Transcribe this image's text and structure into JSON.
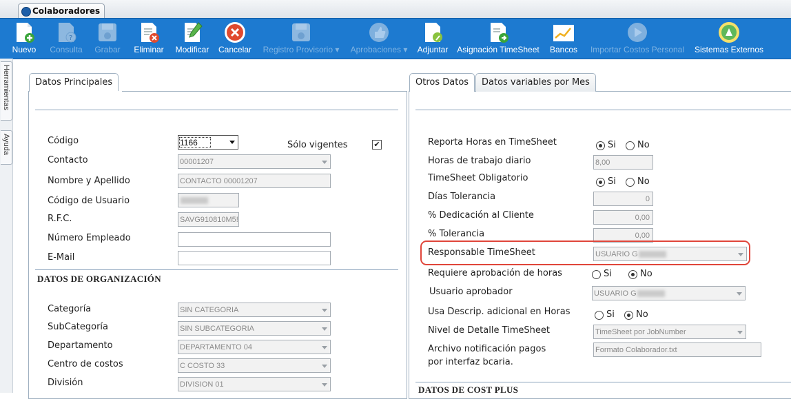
{
  "window": {
    "tab_title": "Colaboradores"
  },
  "toolbar": {
    "nuevo": "Nuevo",
    "consulta": "Consulta",
    "grabar": "Grabar",
    "eliminar": "Eliminar",
    "modificar": "Modificar",
    "cancelar": "Cancelar",
    "registro_provisorio": "Registro Provisorio ▾",
    "aprobaciones": "Aprobaciones ▾",
    "adjuntar": "Adjuntar",
    "asignacion": "Asignación TimeSheet",
    "bancos": "Bancos",
    "importar": "Importar Costos Personal",
    "sistemas": "Sistemas Externos"
  },
  "sidebar": {
    "herramientas": "Herramientas",
    "ayuda": "Ayuda"
  },
  "left": {
    "tab": "Datos Principales",
    "codigo_label": "Código",
    "codigo_value": "1166",
    "solo_vigentes": "Sólo vigentes",
    "solo_vigentes_checked": true,
    "contacto_label": "Contacto",
    "contacto_value": "00001207",
    "nombre_label": "Nombre y Apellido",
    "nombre_value": "CONTACTO 00001207",
    "usuario_label": "Código de Usuario",
    "rfc_label": "R.F.C.",
    "rfc_value": "SAVG910810M5!",
    "empleado_label": "Número Empleado",
    "email_label": "E-Mail",
    "org_heading": "DATOS DE ORGANIZACIÓN",
    "categoria_label": "Categoría",
    "categoria_value": "SIN CATEGORIA",
    "subcategoria_label": "SubCategoría",
    "subcategoria_value": "SIN SUBCATEGORIA",
    "departamento_label": "Departamento",
    "departamento_value": "DEPARTAMENTO 04",
    "centro_label": "Centro de costos",
    "centro_value": "C COSTO 33",
    "division_label": "División",
    "division_value": "DIVISION 01"
  },
  "right": {
    "tab1": "Otros Datos",
    "tab2": "Datos variables por Mes",
    "reporta_label": "Reporta Horas en TimeSheet",
    "si": "Si",
    "no": "No",
    "horas_label": "Horas de trabajo diario",
    "horas_value": "8,00",
    "obligatorio_label": "TimeSheet Obligatorio",
    "dias_label": "Días Tolerancia",
    "dias_value": "0",
    "dedicacion_label": "% Dedicación al Cliente",
    "dedicacion_value": "0,00",
    "tolerancia_label": "% Tolerancia",
    "tolerancia_value": "0,00",
    "responsable_label": "Responsable TimeSheet",
    "responsable_value": "USUARIO G",
    "requiere_label": "Requiere aprobación de horas",
    "aprobador_label": "Usuario aprobador",
    "aprobador_value": "USUARIO G",
    "descrip_label": "Usa Descrip. adicional en Horas",
    "nivel_label": "Nivel de Detalle TimeSheet",
    "nivel_value": "TimeSheet por JobNumber",
    "archivo_label_1": "Archivo notificación pagos",
    "archivo_label_2": "por interfaz bcaria.",
    "archivo_value": "Formato Colaborador.txt",
    "cost_heading": "DATOS DE COST PLUS"
  },
  "colors": {
    "toolbar": "#1d7ad0",
    "highlight": "#e0453a"
  }
}
